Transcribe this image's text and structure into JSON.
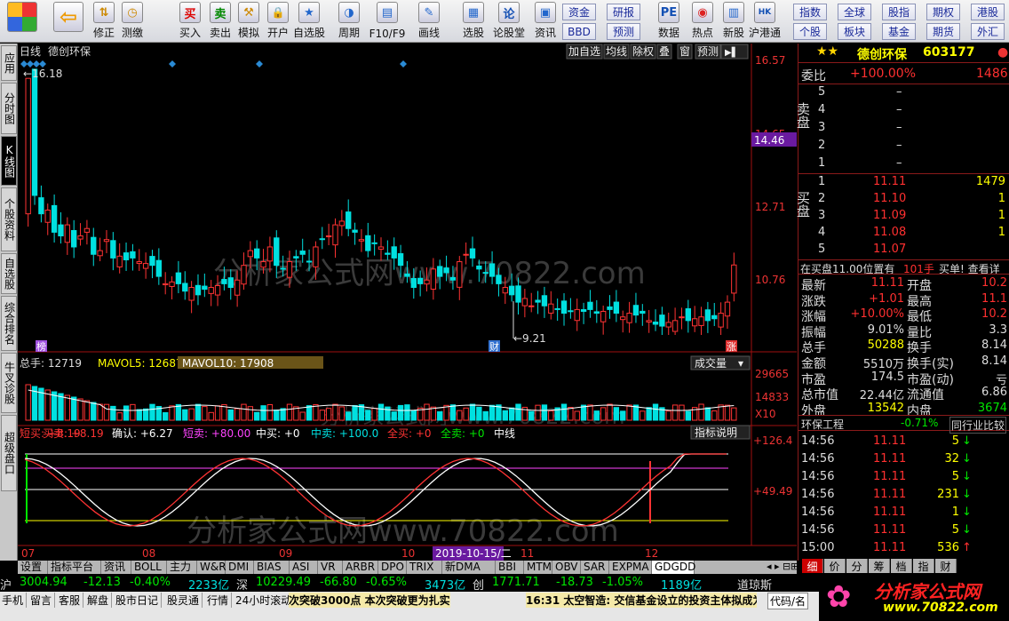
{
  "toolbar": {
    "buttons": [
      {
        "label": "",
        "icon": "app-logo-icon"
      },
      {
        "label": "",
        "icon": "back-arrow-icon"
      },
      {
        "label": "修正",
        "icon": "up-down-icon"
      },
      {
        "label": "测缴",
        "icon": "clock-icon"
      },
      {
        "label": "买入",
        "icon": "buy-icon",
        "glyph": "买"
      },
      {
        "label": "卖出",
        "icon": "sell-icon",
        "glyph": "卖"
      },
      {
        "label": "模拟",
        "icon": "hammer-icon"
      },
      {
        "label": "开户",
        "icon": "lock-icon"
      },
      {
        "label": "自选股",
        "icon": "star-icon"
      },
      {
        "label": "周期",
        "icon": "period-icon"
      },
      {
        "label": "F10/F9",
        "icon": "f10-icon"
      },
      {
        "label": "画线",
        "icon": "pencil-icon"
      },
      {
        "label": "选股",
        "icon": "select-stock-icon"
      },
      {
        "label": "论股堂",
        "icon": "forum-icon",
        "glyph": "论"
      },
      {
        "label": "资讯",
        "icon": "news-icon"
      },
      {
        "label": "数据",
        "icon": "pe-data-icon",
        "glyph": "PE"
      },
      {
        "label": "热点",
        "icon": "hotspot-icon"
      },
      {
        "label": "新股",
        "icon": "new-stock-icon"
      },
      {
        "label": "沪港通",
        "icon": "hk-connect-icon"
      }
    ],
    "small_buttons": [
      "资金",
      "BBD",
      "研报",
      "预测",
      "指数",
      "个股",
      "全球",
      "板块",
      "股指",
      "基金",
      "期权",
      "期货",
      "港股",
      "外汇"
    ]
  },
  "left_tabs": [
    "应用",
    "分时图",
    "K线图",
    "个股资料",
    "自选股",
    "综合排名",
    "牛叉诊股",
    "超级盘口"
  ],
  "chart": {
    "period_label": "日线",
    "stock_title": "德创环保",
    "top_buttons": [
      "加自选",
      "均线",
      "除权",
      "叠",
      "窗",
      "预测"
    ],
    "price_axis": [
      "16.57",
      "14.65",
      "14.46",
      "12.71",
      "10.76"
    ],
    "current_price_tag": "14.46",
    "high_label": "16.18",
    "low_label": "9.21",
    "event_markers": [
      "榜",
      "财",
      "涨"
    ],
    "watermark": "分析家公式网www.70822.com",
    "volume_header": {
      "total": "总手: 12719",
      "mavol5": "MAVOL5: 12687",
      "mavol10": "MAVOL10: 17908"
    },
    "volume_dropdown": "成交量",
    "volume_axis": [
      "29665",
      "14833",
      "X10"
    ],
    "indicator_header": {
      "short_buy": "短买: +8.19",
      "buy": "买卖: +8.19",
      "confirm": "确认: +6.27",
      "short_sell": "短卖: +80.00",
      "mid_buy": "中买: +0",
      "mid_sell": "中卖: +100.0",
      "all_buy": "全买: +0",
      "all_sell": "全卖: +0",
      "tail": "中线"
    },
    "indicator_explain": "指标说明",
    "indicator_axis": [
      "+126.4",
      "+49.49"
    ],
    "date_axis": [
      "07",
      "08",
      "09",
      "10",
      "11",
      "12"
    ],
    "date_cursor": "2019-10-15/二"
  },
  "chart_data": {
    "type": "candlestick",
    "title": "德创环保 日线",
    "ylim": [
      9.21,
      16.57
    ],
    "high": 16.18,
    "low": 9.21,
    "last": 11.11,
    "months": [
      "07",
      "08",
      "09",
      "10",
      "11",
      "12"
    ]
  },
  "quote": {
    "name": "德创环保",
    "code": "603177",
    "weibi_label": "委比",
    "weibi_value": "+100.00%",
    "weibi_diff": "1486",
    "sell_label": "卖盘",
    "sell_rows": [
      {
        "level": "5",
        "price": "–",
        "vol": ""
      },
      {
        "level": "4",
        "price": "–",
        "vol": ""
      },
      {
        "level": "3",
        "price": "–",
        "vol": ""
      },
      {
        "level": "2",
        "price": "–",
        "vol": ""
      },
      {
        "level": "1",
        "price": "–",
        "vol": ""
      }
    ],
    "buy_label": "买盘",
    "buy_rows": [
      {
        "level": "1",
        "price": "11.11",
        "vol": "1479"
      },
      {
        "level": "2",
        "price": "11.10",
        "vol": "1"
      },
      {
        "level": "3",
        "price": "11.09",
        "vol": "1"
      },
      {
        "level": "4",
        "price": "11.08",
        "vol": "1"
      },
      {
        "level": "5",
        "price": "11.07",
        "vol": ""
      }
    ],
    "notice": {
      "text": "在买盘11.00位置有",
      "qty": "101手",
      "tail": "买单! 查看详"
    },
    "stats": [
      {
        "l1": "最新",
        "v1": "11.11",
        "l2": "开盘",
        "v2": "10.2"
      },
      {
        "l1": "涨跌",
        "v1": "+1.01",
        "l2": "最高",
        "v2": "11.1"
      },
      {
        "l1": "涨幅",
        "v1": "+10.00%",
        "l2": "最低",
        "v2": "10.2"
      },
      {
        "l1": "振幅",
        "v1": "9.01%",
        "l2": "量比",
        "v2": "3.3"
      },
      {
        "l1": "总手",
        "v1": "50288",
        "l2": "换手",
        "v2": "8.14"
      },
      {
        "l1": "金额",
        "v1": "5510万",
        "l2": "换手(实)",
        "v2": "8.14"
      },
      {
        "l1": "市盈",
        "v1": "174.5",
        "l2": "市盈(动)",
        "v2": "亏"
      },
      {
        "l1": "总市值",
        "v1": "22.44亿",
        "l2": "流通值",
        "v2": "6.86"
      },
      {
        "l1": "外盘",
        "v1": "13542",
        "l2": "内盘",
        "v2": "3674"
      }
    ],
    "industry": {
      "name": "环保工程",
      "change": "-0.71%",
      "link": "同行业比较"
    },
    "ticks": [
      {
        "time": "14:56",
        "price": "11.11",
        "vol": "5",
        "dir": "down"
      },
      {
        "time": "14:56",
        "price": "11.11",
        "vol": "32",
        "dir": "down"
      },
      {
        "time": "14:56",
        "price": "11.11",
        "vol": "5",
        "dir": "down"
      },
      {
        "time": "14:56",
        "price": "11.11",
        "vol": "231",
        "dir": "down"
      },
      {
        "time": "14:56",
        "price": "11.11",
        "vol": "1",
        "dir": "down"
      },
      {
        "time": "14:56",
        "price": "11.11",
        "vol": "5",
        "dir": "down"
      },
      {
        "time": "15:00",
        "price": "11.11",
        "vol": "536",
        "dir": "up"
      }
    ],
    "tabs": [
      "细",
      "价",
      "分",
      "筹",
      "档",
      "指",
      "财"
    ]
  },
  "bottom_tabs": [
    "设置",
    "指标平台",
    "资讯",
    "BOLL",
    "主力",
    "W&R",
    "DMI",
    "BIAS",
    "ASI",
    "VR",
    "ARBR",
    "DPO",
    "TRIX",
    "新DMA",
    "BBI",
    "MTM",
    "OBV",
    "SAR",
    "EXPMA",
    "GDGDD"
  ],
  "status": {
    "sh": {
      "name": "沪",
      "index": "3004.94",
      "chg": "-12.13",
      "pct": "-0.40%",
      "amount": "2233亿"
    },
    "sz": {
      "name": "深",
      "index": "10229.49",
      "chg": "-66.80",
      "pct": "-0.65%",
      "amount": "3473亿"
    },
    "cy": {
      "name": "创",
      "index": "1771.71",
      "chg": "-18.73",
      "pct": "-1.05%",
      "amount": "1189亿"
    },
    "tail": "道琼斯"
  },
  "bottom_bar": {
    "items": [
      "手机",
      "留言",
      "客服",
      "解盘",
      "股市日记",
      "股灵通",
      "行情",
      "24小时滚动"
    ],
    "news1": "次突破3000点 本次突破更为扎实",
    "news2": "16:31 太空智造: 交信基金设立的投资主体拟成为公",
    "code_btn": "代码/名",
    "logo": "分析家公式网",
    "logo_url": "www.70822.com"
  }
}
